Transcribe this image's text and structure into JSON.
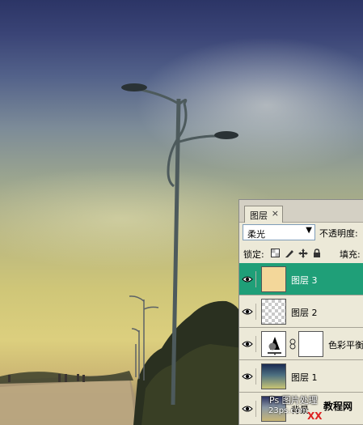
{
  "panel": {
    "tab_label": "图层",
    "tab_close": "×",
    "blend_mode": "柔光",
    "blend_arrow": "▼",
    "opacity_label": "不透明度:",
    "lock_label": "锁定:",
    "fill_label": "填充:",
    "lock_icons": [
      "lock-transparent-icon",
      "lock-paint-icon",
      "lock-move-icon",
      "lock-all-icon"
    ],
    "layers": [
      {
        "name": "图层 3",
        "selected": true,
        "thumb": "cream-fill"
      },
      {
        "name": "图层 2",
        "selected": false,
        "thumb": "transparent"
      },
      {
        "name": "色彩平衡",
        "selected": false,
        "thumb": "adjustment"
      },
      {
        "name": "图层 1",
        "selected": false,
        "thumb": "gradient"
      },
      {
        "name": "背景",
        "selected": false,
        "thumb": "photo"
      }
    ]
  },
  "watermark": {
    "line1": "Ps 图片处理",
    "line2": "23ps.com",
    "line3": "教程网",
    "line4": "XX"
  },
  "colors": {
    "selected_layer": "#1f9f78",
    "panel_bg": "#ece9d8",
    "sky_top": "#2c3566",
    "sky_horizon": "#dccf7e"
  }
}
